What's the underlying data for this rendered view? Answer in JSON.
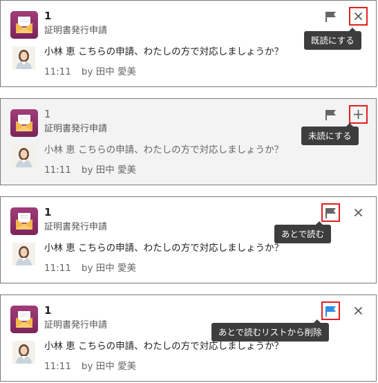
{
  "notifications": [
    {
      "count": "1",
      "app_name": "証明書発行申請",
      "message": "小林 恵 こちらの申請、わたしの方で対応しましょうか？",
      "time": "11:11",
      "by": "by 田中 愛美",
      "state": "unread",
      "flag_color": "#666666",
      "side_icon": "close-icon",
      "highlighted_action": "side",
      "tooltip": "既読にする"
    },
    {
      "count": "1",
      "app_name": "証明書発行申請",
      "message": "小林 恵 こちらの申請、わたしの方で対応しましょうか？",
      "time": "11:11",
      "by": "by 田中 愛美",
      "state": "read",
      "flag_color": "#666666",
      "side_icon": "plus-icon",
      "highlighted_action": "side",
      "tooltip": "未読にする"
    },
    {
      "count": "1",
      "app_name": "証明書発行申請",
      "message": "小林 恵 こちらの申請、わたしの方で対応しましょうか？",
      "time": "11:11",
      "by": "by 田中 愛美",
      "state": "unread",
      "flag_color": "#666666",
      "side_icon": "close-icon",
      "highlighted_action": "flag",
      "tooltip": "あとで読む"
    },
    {
      "count": "1",
      "app_name": "証明書発行申請",
      "message": "小林 恵 こちらの申請、わたしの方で対応しましょうか？",
      "time": "11:11",
      "by": "by 田中 愛美",
      "state": "unread",
      "flag_color": "#2f8fe0",
      "side_icon": "close-icon",
      "highlighted_action": "flag",
      "tooltip": "あとで読むリストから削除"
    }
  ],
  "colors": {
    "highlight_border": "#e02020",
    "app_icon": "#8e2f69",
    "tooltip_bg": "#3d3d3d"
  }
}
